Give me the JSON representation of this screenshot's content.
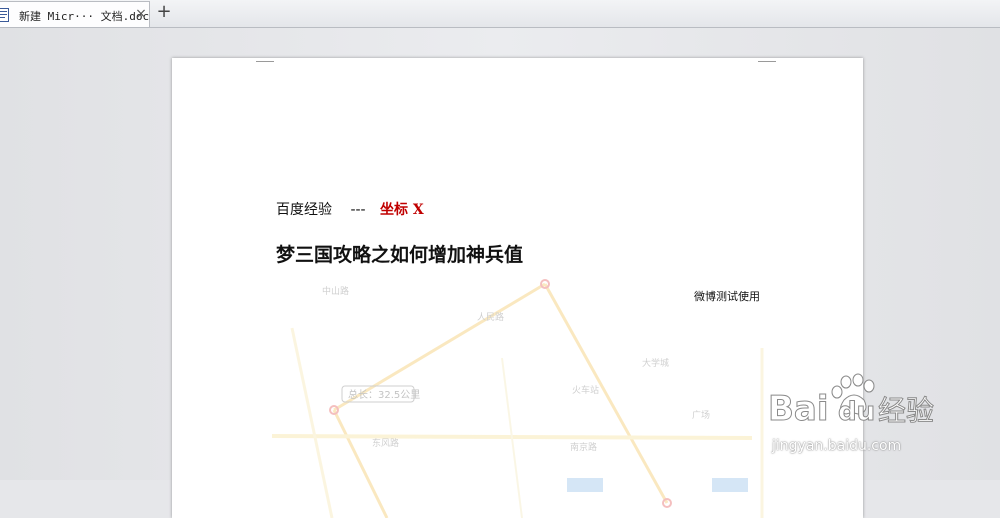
{
  "tab": {
    "title": "新建 Micr··· 文档.doc",
    "close_icon": "close-icon",
    "new_tab_icon": "plus-icon"
  },
  "document": {
    "header_left": "百度经验",
    "header_sep": "---",
    "header_coord": "坐标 X",
    "title": "梦三国攻略之如何增加神兵值",
    "note": "微博测试使用",
    "map_labels": [
      "总长：32.5公里",
      "中山路",
      "人民路",
      "火车站",
      "东风路",
      "南京路",
      "广场",
      "大学城"
    ]
  },
  "watermark": {
    "brand": "Bai",
    "brand2": "du",
    "brand_cn": "经验",
    "url": "jingyan.baidu.com"
  },
  "colors": {
    "accent_red": "#c00000",
    "baidu_blue": "#2b73d8"
  }
}
